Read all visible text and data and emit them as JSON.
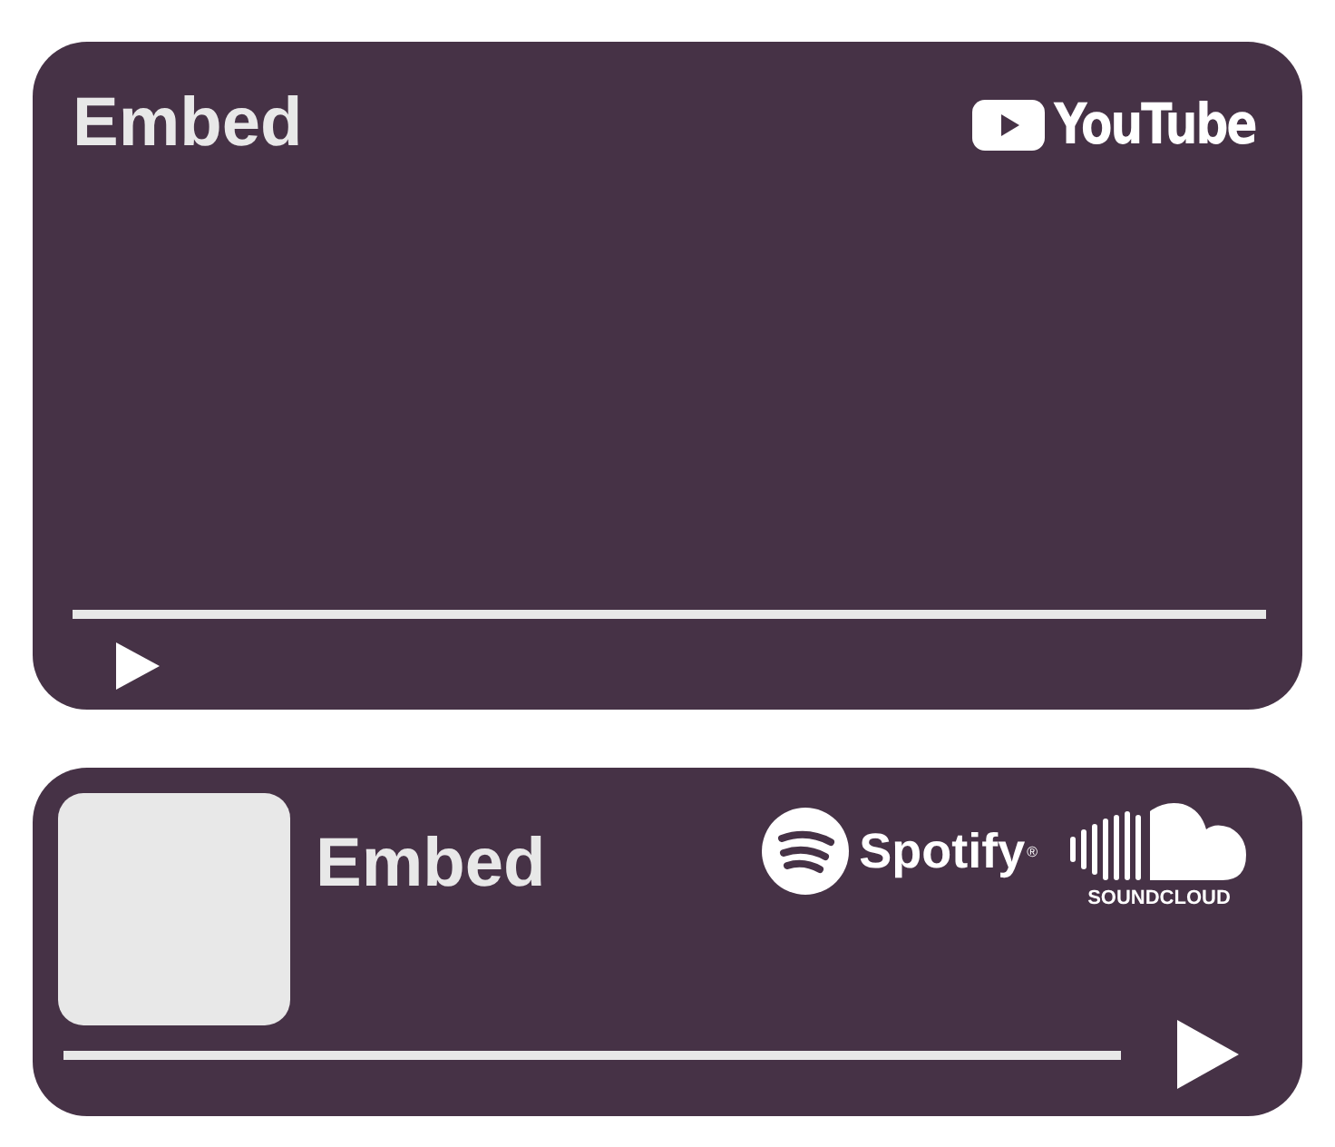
{
  "video_card": {
    "title": "Embed",
    "logo": "YouTube"
  },
  "audio_card": {
    "title": "Embed",
    "logos": [
      {
        "kind": "spotify",
        "label": "Spotify",
        "mark": "®"
      },
      {
        "kind": "soundcloud",
        "label": "SOUNDCLOUD"
      }
    ]
  }
}
